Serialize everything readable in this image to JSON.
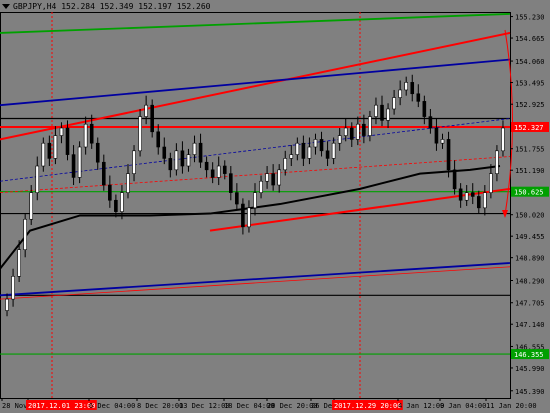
{
  "header": {
    "menu_icon": "triangle-down-icon",
    "symbol_tf": "GBPJPY,H4",
    "ohlc": "152.284 152.349 152.197 152.260"
  },
  "colors": {
    "background": "#808080",
    "axis": "#000000",
    "candle": "#000000",
    "red_level": "#ff0000",
    "green_level": "#00a000",
    "blue_level": "#0000a0",
    "black_level": "#000000",
    "highlight_label_bg": "#ff0000",
    "price_label_red_bg": "#ff0000",
    "price_label_green_bg": "#00a000"
  },
  "chart_data": {
    "type": "candlestick",
    "symbol": "GBPJPY",
    "timeframe": "H4",
    "yaxis_ticks": [
      "155.230",
      "154.665",
      "154.060",
      "153.495",
      "152.925",
      "152.360",
      "151.755",
      "151.190",
      "150.625",
      "150.020",
      "149.455",
      "148.890",
      "148.290",
      "147.705",
      "147.140",
      "146.555",
      "145.990",
      "145.390"
    ],
    "ylim": [
      145.2,
      155.35
    ],
    "xaxis_ticks": [
      {
        "label": "28 Nov 2017",
        "highlight": false
      },
      {
        "label": "2017.12.01 23:00",
        "highlight": true
      },
      {
        "label": "6 Dec 04:00",
        "highlight": false
      },
      {
        "label": "8 Dec 20:00",
        "highlight": false
      },
      {
        "label": "13 Dec 12:00",
        "highlight": false
      },
      {
        "label": "18 Dec 04:00",
        "highlight": false
      },
      {
        "label": "20 Dec 20:00",
        "highlight": false
      },
      {
        "label": "26 Dec 12:00",
        "highlight": false
      },
      {
        "label": "2017.12.29 20:00",
        "highlight": true
      },
      {
        "label": "4 Jan 12:00",
        "highlight": false
      },
      {
        "label": "9 Jan 04:00",
        "highlight": false
      },
      {
        "label": "11 Jan 20:00",
        "highlight": false
      }
    ],
    "price_labels": [
      {
        "value": "152.327",
        "color": "red"
      },
      {
        "value": "150.625",
        "color": "green"
      },
      {
        "value": "146.355",
        "color": "green"
      }
    ],
    "horizontal_levels": [
      {
        "price": 152.55,
        "color": "black"
      },
      {
        "price": 152.327,
        "color": "red"
      },
      {
        "price": 150.625,
        "color": "green"
      },
      {
        "price": 150.05,
        "color": "black"
      },
      {
        "price": 147.9,
        "color": "black"
      },
      {
        "price": 146.355,
        "color": "green"
      }
    ],
    "closes": [
      147.8,
      148.4,
      149.1,
      149.9,
      150.6,
      151.3,
      151.9,
      151.5,
      152.1,
      152.3,
      151.6,
      151.0,
      151.8,
      152.4,
      151.9,
      151.4,
      150.8,
      150.4,
      150.1,
      150.6,
      151.1,
      151.7,
      152.6,
      152.9,
      152.2,
      151.8,
      151.5,
      151.2,
      151.7,
      151.3,
      151.6,
      151.9,
      151.4,
      151.2,
      151.0,
      151.3,
      151.1,
      150.6,
      150.3,
      149.7,
      150.2,
      150.6,
      150.9,
      151.1,
      150.8,
      151.2,
      151.5,
      151.6,
      151.9,
      151.5,
      151.8,
      152.0,
      151.7,
      151.5,
      151.9,
      152.1,
      152.3,
      152.0,
      152.4,
      152.1,
      152.6,
      152.9,
      152.5,
      152.8,
      153.1,
      153.3,
      153.5,
      153.2,
      153.0,
      152.6,
      152.3,
      151.9,
      152.0,
      151.2,
      150.7,
      150.4,
      150.6,
      150.5,
      150.2,
      150.6,
      151.1,
      151.7,
      152.3
    ]
  }
}
